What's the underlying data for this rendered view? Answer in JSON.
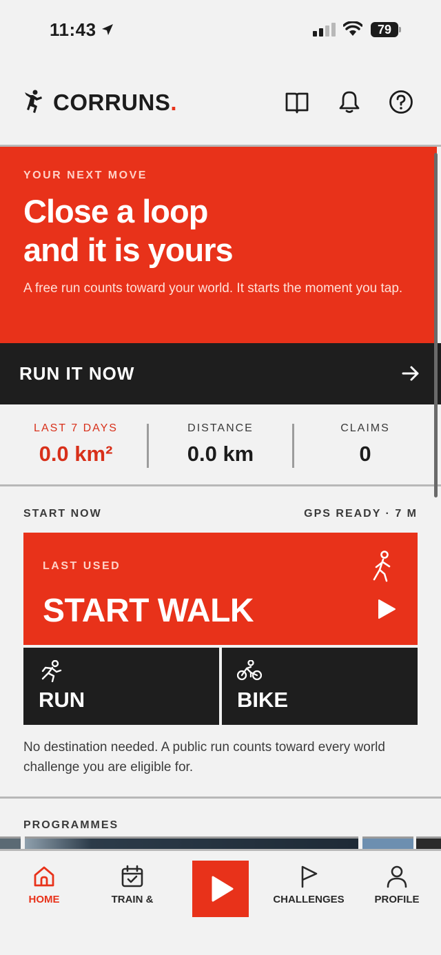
{
  "status_bar": {
    "time": "11:43",
    "battery": "79"
  },
  "header": {
    "brand": "CORRUNS",
    "brand_dot": "."
  },
  "hero": {
    "eyebrow": "YOUR NEXT MOVE",
    "title_line1": "Close a loop",
    "title_line2": "and it is yours",
    "subtitle": "A free run counts toward your world. It starts the moment you tap."
  },
  "run_now": {
    "label": "RUN IT NOW"
  },
  "stats": [
    {
      "label": "LAST 7 DAYS",
      "value": "0.0 km²"
    },
    {
      "label": "DISTANCE",
      "value": "0.0 km"
    },
    {
      "label": "CLAIMS",
      "value": "0"
    }
  ],
  "start_now": {
    "heading": "START NOW",
    "gps": "GPS READY · 7 M",
    "last_used_label": "LAST USED",
    "walk_label": "START WALK",
    "run_label": "RUN",
    "bike_label": "BIKE",
    "note": "No destination needed. A public run counts toward every world challenge you are eligible for."
  },
  "programmes": {
    "heading": "PROGRAMMES"
  },
  "tabs": [
    {
      "label": "HOME",
      "icon": "home-icon",
      "active": true
    },
    {
      "label": "TRAIN &",
      "icon": "calendar-check-icon",
      "active": false
    },
    {
      "label": "",
      "icon": "play-icon",
      "active": false
    },
    {
      "label": "CHALLENGES",
      "icon": "flag-icon",
      "active": false
    },
    {
      "label": "PROFILE",
      "icon": "person-icon",
      "active": false
    }
  ],
  "colors": {
    "accent": "#e8321a",
    "dark": "#1e1e1e",
    "background": "#f2f2f2"
  }
}
